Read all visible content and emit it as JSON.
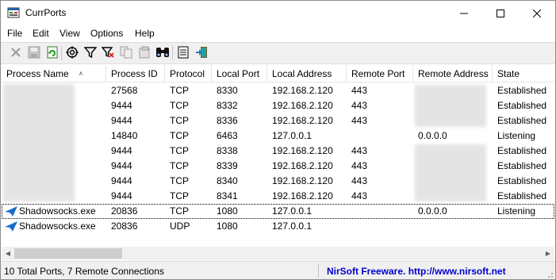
{
  "window": {
    "title": "CurrPorts"
  },
  "menu": [
    "File",
    "Edit",
    "View",
    "Options",
    "Help"
  ],
  "toolbar": {
    "icons": [
      "close-connection-icon",
      "save-icon",
      "refresh-icon",
      "properties-icon",
      "filter-icon",
      "clear-filter-icon",
      "copy-icon",
      "html-report-icon",
      "find-icon",
      "report-icon",
      "exit-icon"
    ]
  },
  "columns": [
    "Process Name",
    "Process ID",
    "Protocol",
    "Local Port",
    "Local Address",
    "Remote Port",
    "Remote Address",
    "State"
  ],
  "rows": [
    {
      "process": "",
      "pid": "27568",
      "protocol": "TCP",
      "local_port": "8330",
      "local_address": "192.168.2.120",
      "remote_port": "443",
      "remote_address": "",
      "state": "Established"
    },
    {
      "process": "",
      "pid": "9444",
      "protocol": "TCP",
      "local_port": "8332",
      "local_address": "192.168.2.120",
      "remote_port": "443",
      "remote_address": "",
      "state": "Established"
    },
    {
      "process": "",
      "pid": "9444",
      "protocol": "TCP",
      "local_port": "8336",
      "local_address": "192.168.2.120",
      "remote_port": "443",
      "remote_address": "",
      "state": "Established"
    },
    {
      "process": "",
      "pid": "14840",
      "protocol": "TCP",
      "local_port": "6463",
      "local_address": "127.0.0.1",
      "remote_port": "",
      "remote_address": "0.0.0.0",
      "state": "Listening"
    },
    {
      "process": "",
      "pid": "9444",
      "protocol": "TCP",
      "local_port": "8338",
      "local_address": "192.168.2.120",
      "remote_port": "443",
      "remote_address": "",
      "state": "Established"
    },
    {
      "process": "",
      "pid": "9444",
      "protocol": "TCP",
      "local_port": "8339",
      "local_address": "192.168.2.120",
      "remote_port": "443",
      "remote_address": "",
      "state": "Established"
    },
    {
      "process": "",
      "pid": "9444",
      "protocol": "TCP",
      "local_port": "8340",
      "local_address": "192.168.2.120",
      "remote_port": "443",
      "remote_address": "",
      "state": "Established"
    },
    {
      "process": "",
      "pid": "9444",
      "protocol": "TCP",
      "local_port": "8341",
      "local_address": "192.168.2.120",
      "remote_port": "443",
      "remote_address": "",
      "state": "Established"
    },
    {
      "process": "Shadowsocks.exe",
      "pid": "20836",
      "protocol": "TCP",
      "local_port": "1080",
      "local_address": "127.0.0.1",
      "remote_port": "",
      "remote_address": "0.0.0.0",
      "state": "Listening"
    },
    {
      "process": "Shadowsocks.exe",
      "pid": "20836",
      "protocol": "UDP",
      "local_port": "1080",
      "local_address": "127.0.0.1",
      "remote_port": "",
      "remote_address": "",
      "state": ""
    }
  ],
  "status": {
    "summary": "10 Total Ports, 7 Remote Connections",
    "credit": "NirSoft Freeware.  http://www.nirsoft.net"
  },
  "colors": {
    "link": "#0000cc",
    "icon_blue": "#1e6fd0"
  }
}
